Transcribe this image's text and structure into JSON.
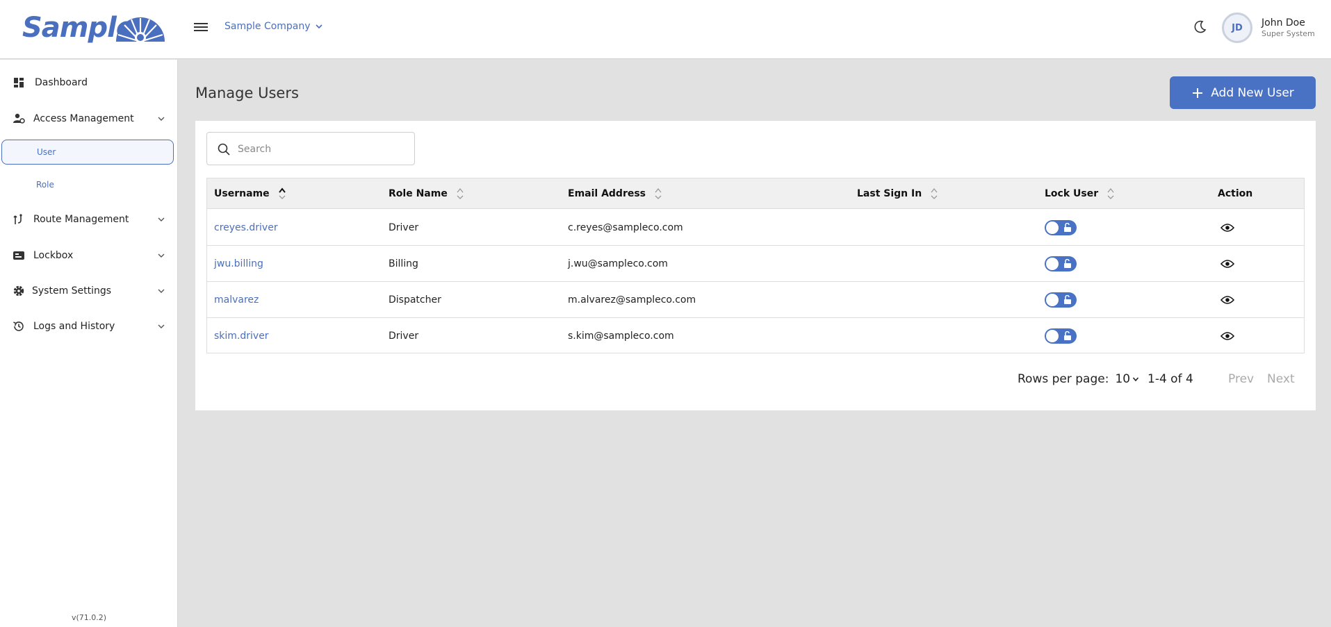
{
  "header": {
    "logo_text": "Sample",
    "company": "Sample Company",
    "user": {
      "initials": "JD",
      "name": "John Doe",
      "role": "Super System"
    }
  },
  "sidebar": {
    "items": [
      {
        "label": "Dashboard",
        "icon": "dashboard-icon"
      },
      {
        "label": "Access Management",
        "icon": "user-gear-icon",
        "sub": [
          {
            "label": "User",
            "active": true
          },
          {
            "label": "Role",
            "active": false
          }
        ]
      },
      {
        "label": "Route Management",
        "icon": "route-icon"
      },
      {
        "label": "Lockbox",
        "icon": "lockbox-icon"
      },
      {
        "label": "System Settings",
        "icon": "gear-icon"
      },
      {
        "label": "Logs and History",
        "icon": "history-icon"
      }
    ],
    "version": "v(71.0.2)"
  },
  "main": {
    "title": "Manage Users",
    "add_button": "Add New User",
    "search_placeholder": "Search",
    "table": {
      "columns": [
        "Username",
        "Role Name",
        "Email Address",
        "Last Sign In",
        "Lock User",
        "Action"
      ],
      "rows": [
        {
          "username": "creyes.driver",
          "role": "Driver",
          "email": "c.reyes@sampleco.com",
          "last_sign_in": "",
          "locked": false
        },
        {
          "username": "jwu.billing",
          "role": "Billing",
          "email": "j.wu@sampleco.com",
          "last_sign_in": "",
          "locked": false
        },
        {
          "username": "malvarez",
          "role": "Dispatcher",
          "email": "m.alvarez@sampleco.com",
          "last_sign_in": "",
          "locked": false
        },
        {
          "username": "skim.driver",
          "role": "Driver",
          "email": "s.kim@sampleco.com",
          "last_sign_in": "",
          "locked": false
        }
      ]
    },
    "pagination": {
      "rows_label": "Rows per page:",
      "rows_value": "10",
      "range": "1-4 of 4",
      "prev": "Prev",
      "next": "Next"
    }
  },
  "colors": {
    "accent": "#4a72c4",
    "link": "#4a6fbe"
  }
}
